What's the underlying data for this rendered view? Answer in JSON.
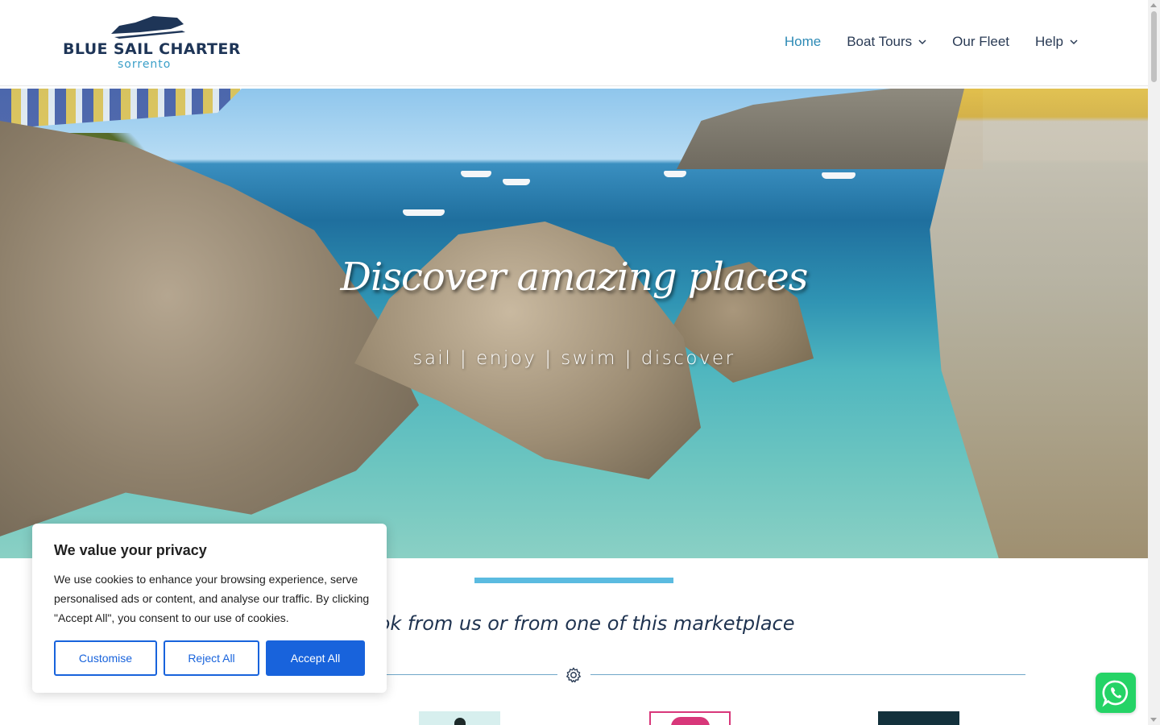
{
  "logo": {
    "brand": "BLUE SAIL CHARTER",
    "sub": "sorrento"
  },
  "nav": [
    {
      "label": "Home",
      "active": true,
      "dropdown": false
    },
    {
      "label": "Boat Tours",
      "active": false,
      "dropdown": true
    },
    {
      "label": "Our Fleet",
      "active": false,
      "dropdown": false
    },
    {
      "label": "Help",
      "active": false,
      "dropdown": true
    }
  ],
  "hero": {
    "title": "Discover amazing places",
    "subtitle": "sail | enjoy | swim | discover"
  },
  "main": {
    "marketplace_text": "Book from us or from one of this marketplace"
  },
  "cookie": {
    "title": "We value your privacy",
    "body": "We use cookies to enhance your browsing experience, serve personalised ads or content, and analyse our traffic. By clicking \"Accept All\", you consent to our use of cookies.",
    "customise": "Customise",
    "reject": "Reject All",
    "accept": "Accept All"
  },
  "colors": {
    "brand_navy": "#1e3557",
    "brand_blue": "#3a9fc8",
    "nav_active": "#2d8ab5",
    "accent_bar": "#5bbbe0",
    "cookie_button": "#1863dc",
    "whatsapp": "#25d366"
  },
  "icons": {
    "logo": "yacht-icon",
    "nav_dropdown": "chevron-down-icon",
    "divider": "gear-icon",
    "chat": "whatsapp-icon"
  }
}
